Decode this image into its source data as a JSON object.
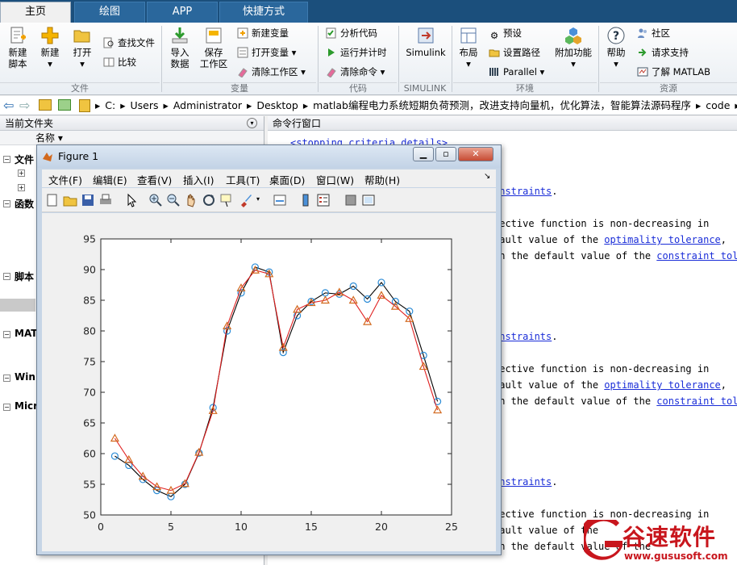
{
  "tabs": [
    "主页",
    "绘图",
    "APP",
    "快捷方式"
  ],
  "ribbon": {
    "file_group": {
      "new_script": "新建\n脚本",
      "new": "新建",
      "open": "打开",
      "find_files": "查找文件",
      "compare": "比较",
      "label": "文件"
    },
    "variable_group": {
      "import": "导入\n数据",
      "save_workspace": "保存\n工作区",
      "new_variable": "新建变量",
      "open_variable": "打开变量",
      "clear_workspace": "清除工作区",
      "label": "变量"
    },
    "code_group": {
      "analyze_code": "分析代码",
      "run_and_time": "运行并计时",
      "clear_commands": "清除命令",
      "label": "代码"
    },
    "simulink_group": {
      "simulink": "Simulink",
      "label": "SIMULINK"
    },
    "environment_group": {
      "layout": "布局",
      "preferences": "预设",
      "set_path": "设置路径",
      "parallel": "Parallel",
      "addons": "附加功能",
      "label": "环境"
    },
    "resources_group": {
      "help": "帮助",
      "community": "社区",
      "request_support": "请求支持",
      "learn_matlab": "了解 MATLAB",
      "label": "资源"
    }
  },
  "address": {
    "segments": [
      "C:",
      "Users",
      "Administrator",
      "Desktop",
      "matlab编程电力系统短期负荷预测，改进支持向量机，优化算法，智能算法源码程序",
      "code"
    ]
  },
  "left_pane": {
    "header": "当前文件夹",
    "column": "名称",
    "sections": [
      "文件",
      "函数",
      "脚本",
      "MAT",
      "Win",
      "Micr"
    ]
  },
  "command_window": {
    "header": "命令行窗口",
    "lines": [
      {
        "text": "<stopping criteria details>",
        "link": true
      },
      {
        "pre": "",
        "link_text": "onstraints",
        "post": "."
      },
      {
        "pre": "jective function is non-decreasing in",
        "link_text": "",
        "post": ""
      },
      {
        "pre": "fault value of the ",
        "link_text": "optimality tolerance",
        "post": ","
      },
      {
        "pre": "in the default value of the ",
        "link_text": "constraint tole",
        "post": ""
      }
    ]
  },
  "figure": {
    "title": "Figure 1",
    "menu": [
      "文件(F)",
      "编辑(E)",
      "查看(V)",
      "插入(I)",
      "工具(T)",
      "桌面(D)",
      "窗口(W)",
      "帮助(H)"
    ],
    "toolbar_icons": [
      "new-figure-icon",
      "open-icon",
      "save-icon",
      "print-icon",
      "pointer-icon",
      "zoom-in-icon",
      "zoom-out-icon",
      "pan-icon",
      "rotate-icon",
      "data-cursor-icon",
      "brush-icon",
      "link-icon",
      "colorbar-icon",
      "legend-icon",
      "hide-tools-icon",
      "show-tools-icon"
    ]
  },
  "chart_data": {
    "type": "line",
    "title": "",
    "xlabel": "",
    "ylabel": "",
    "xlim": [
      0,
      25
    ],
    "ylim": [
      50,
      95
    ],
    "xticks": [
      0,
      5,
      10,
      15,
      20,
      25
    ],
    "yticks": [
      50,
      55,
      60,
      65,
      70,
      75,
      80,
      85,
      90,
      95
    ],
    "x": [
      1,
      2,
      3,
      4,
      5,
      6,
      7,
      8,
      9,
      10,
      11,
      12,
      13,
      14,
      15,
      16,
      17,
      18,
      19,
      20,
      21,
      22,
      23,
      24
    ],
    "series": [
      {
        "name": "",
        "color": "#000000",
        "marker": "circle",
        "marker_color": "#2a8bd6",
        "values": [
          59.6,
          58.1,
          55.8,
          54.0,
          53.0,
          55.0,
          60.1,
          67.5,
          80.0,
          86.2,
          90.4,
          89.6,
          76.5,
          82.5,
          84.8,
          86.2,
          86.0,
          87.3,
          85.2,
          87.9,
          84.8,
          83.2,
          76.0,
          68.5
        ]
      },
      {
        "name": "",
        "color": "#e02020",
        "marker": "triangle",
        "marker_color": "#d2691e",
        "values": [
          62.5,
          59.0,
          56.3,
          54.6,
          54.0,
          55.1,
          60.2,
          67.0,
          80.8,
          87.0,
          89.9,
          89.3,
          77.3,
          83.5,
          84.6,
          85.0,
          86.3,
          85.0,
          81.5,
          85.8,
          84.0,
          82.0,
          74.2,
          67.1
        ]
      }
    ],
    "grid": false
  },
  "watermark": {
    "text": "谷速软件",
    "url": "www.gususoft.com"
  }
}
